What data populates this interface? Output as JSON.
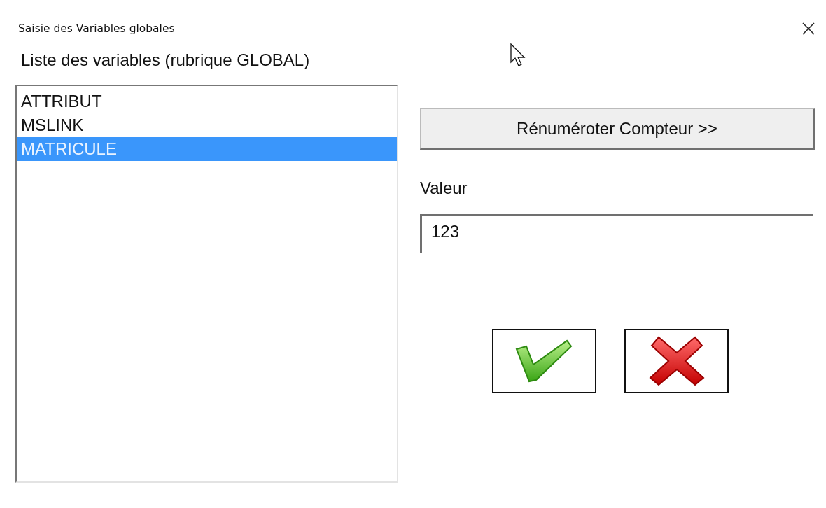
{
  "window": {
    "title": "Saisie des Variables globales"
  },
  "list_label": "Liste des variables (rubrique GLOBAL)",
  "variables": [
    {
      "label": "ATTRIBUT",
      "selected": false
    },
    {
      "label": "MSLINK",
      "selected": false
    },
    {
      "label": "MATRICULE",
      "selected": true
    }
  ],
  "renumber_button": "Rénuméroter Compteur >>",
  "value_label": "Valeur",
  "value_field": {
    "value": "123"
  }
}
